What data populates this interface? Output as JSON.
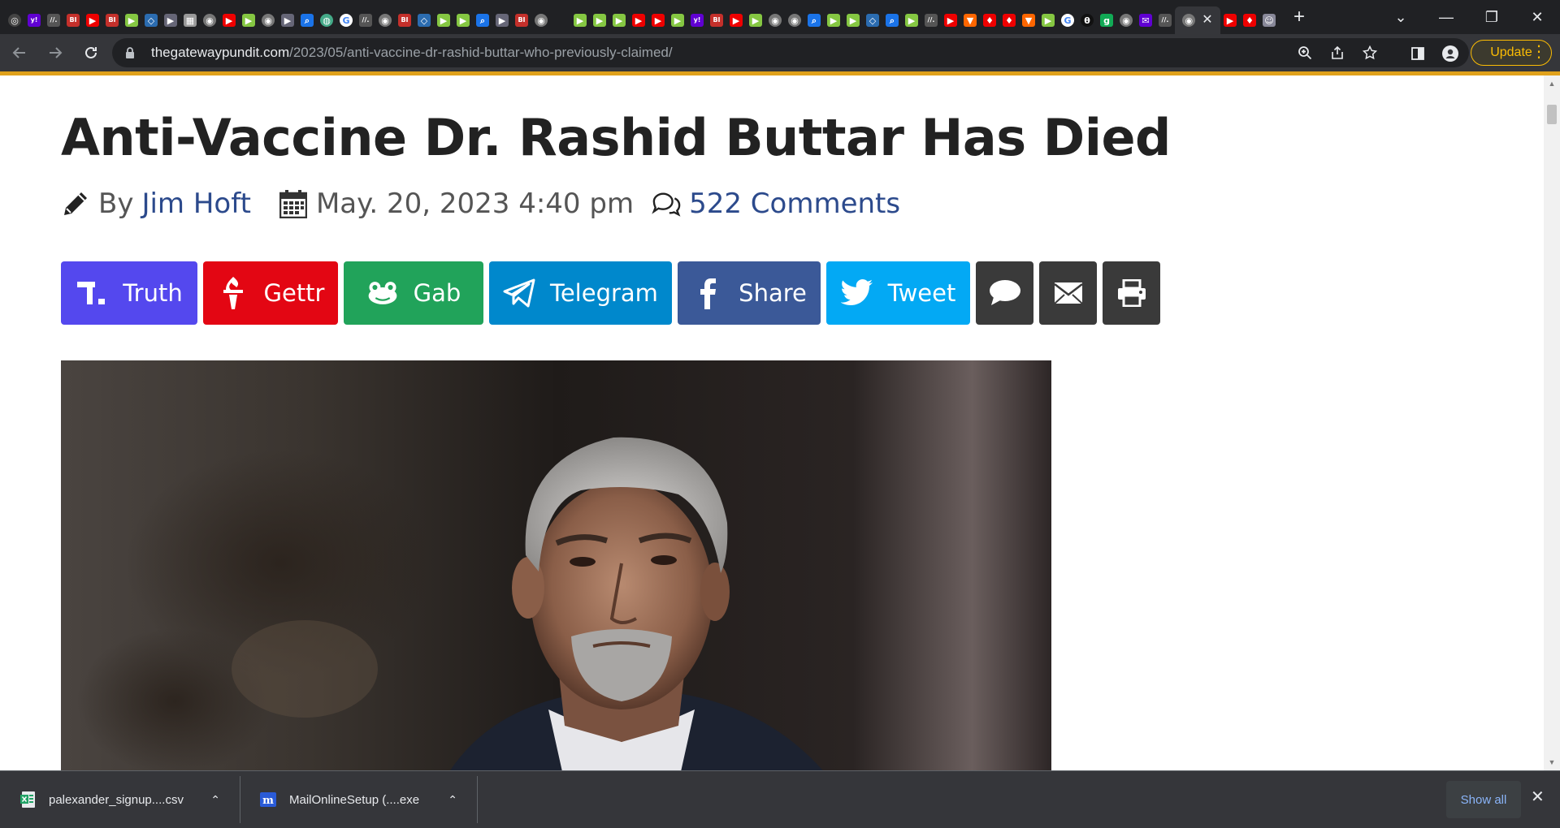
{
  "tabs": [
    {
      "icon": "chrome-favicon",
      "color": "#444",
      "glyph": "◎",
      "circle": true
    },
    {
      "icon": "yahoo-favicon",
      "color": "#6001d2",
      "glyph": "y!"
    },
    {
      "icon": "news-favicon",
      "color": "#555",
      "glyph": "//."
    },
    {
      "icon": "bi-favicon",
      "color": "#c4302b",
      "glyph": "BI"
    },
    {
      "icon": "youtube-favicon",
      "color": "#e00",
      "glyph": "▶"
    },
    {
      "icon": "bi-favicon",
      "color": "#c4302b",
      "glyph": "BI"
    },
    {
      "icon": "rumble-favicon",
      "color": "#85c742",
      "glyph": "▶"
    },
    {
      "icon": "shield-favicon",
      "color": "#2b6cb0",
      "glyph": "◇"
    },
    {
      "icon": "flag-favicon",
      "color": "#667",
      "glyph": "▶"
    },
    {
      "icon": "grid-favicon",
      "color": "#999",
      "glyph": "▦"
    },
    {
      "icon": "globe-favicon",
      "color": "#777",
      "glyph": "◉",
      "circle": true
    },
    {
      "icon": "youtube-favicon",
      "color": "#e00",
      "glyph": "▶"
    },
    {
      "icon": "rumble-favicon",
      "color": "#85c742",
      "glyph": "▶"
    },
    {
      "icon": "globe-favicon",
      "color": "#777",
      "glyph": "◉",
      "circle": true
    },
    {
      "icon": "flag-favicon",
      "color": "#667",
      "glyph": "▶"
    },
    {
      "icon": "search-favicon",
      "color": "#1a73e8",
      "glyph": "⌕"
    },
    {
      "icon": "site-favicon",
      "color": "#4a8",
      "glyph": "◍",
      "circle": true
    },
    {
      "icon": "google-favicon",
      "color": "#fff",
      "glyph": "G",
      "circle": true,
      "text": "#4285f4"
    },
    {
      "icon": "news-favicon",
      "color": "#555",
      "glyph": "//."
    },
    {
      "icon": "globe-favicon",
      "color": "#777",
      "glyph": "◉",
      "circle": true
    },
    {
      "icon": "bi-favicon",
      "color": "#c4302b",
      "glyph": "BI"
    },
    {
      "icon": "shield-favicon",
      "color": "#2b6cb0",
      "glyph": "◇"
    },
    {
      "icon": "rumble-favicon",
      "color": "#85c742",
      "glyph": "▶"
    },
    {
      "icon": "rumble-favicon",
      "color": "#85c742",
      "glyph": "▶"
    },
    {
      "icon": "search-favicon",
      "color": "#1a73e8",
      "glyph": "⌕"
    },
    {
      "icon": "flag-favicon",
      "color": "#667",
      "glyph": "▶"
    },
    {
      "icon": "bi-favicon",
      "color": "#c4302b",
      "glyph": "BI"
    },
    {
      "icon": "globe-favicon",
      "color": "#777",
      "glyph": "◉",
      "circle": true
    },
    {
      "icon": "blank-favicon",
      "color": "#202124",
      "glyph": ""
    },
    {
      "icon": "rumble-favicon",
      "color": "#85c742",
      "glyph": "▶"
    },
    {
      "icon": "rumble-favicon",
      "color": "#85c742",
      "glyph": "▶"
    },
    {
      "icon": "rumble-favicon",
      "color": "#85c742",
      "glyph": "▶"
    },
    {
      "icon": "youtube-favicon",
      "color": "#e00",
      "glyph": "▶"
    },
    {
      "icon": "youtube-favicon",
      "color": "#e00",
      "glyph": "▶"
    },
    {
      "icon": "rumble-favicon",
      "color": "#85c742",
      "glyph": "▶"
    },
    {
      "icon": "yahoo-favicon",
      "color": "#6001d2",
      "glyph": "y!"
    },
    {
      "icon": "bi-favicon",
      "color": "#c4302b",
      "glyph": "BI"
    },
    {
      "icon": "youtube-favicon",
      "color": "#e00",
      "glyph": "▶"
    },
    {
      "icon": "rumble-favicon",
      "color": "#85c742",
      "glyph": "▶"
    },
    {
      "icon": "globe-favicon",
      "color": "#777",
      "glyph": "◉",
      "circle": true
    },
    {
      "icon": "globe-favicon",
      "color": "#777",
      "glyph": "◉",
      "circle": true
    },
    {
      "icon": "search-favicon",
      "color": "#1a73e8",
      "glyph": "⌕"
    },
    {
      "icon": "rumble-favicon",
      "color": "#85c742",
      "glyph": "▶"
    },
    {
      "icon": "rumble-favicon",
      "color": "#85c742",
      "glyph": "▶"
    },
    {
      "icon": "shield-favicon",
      "color": "#2b6cb0",
      "glyph": "◇"
    },
    {
      "icon": "search-favicon",
      "color": "#1a73e8",
      "glyph": "⌕"
    },
    {
      "icon": "rumble-favicon",
      "color": "#85c742",
      "glyph": "▶"
    },
    {
      "icon": "news-favicon",
      "color": "#555",
      "glyph": "//."
    },
    {
      "icon": "youtube-favicon",
      "color": "#e00",
      "glyph": "▶"
    },
    {
      "icon": "bookmark-favicon",
      "color": "#f60",
      "glyph": "▼"
    },
    {
      "icon": "torch-favicon",
      "color": "#e00",
      "glyph": "♦"
    },
    {
      "icon": "torch-favicon",
      "color": "#e00",
      "glyph": "♦"
    },
    {
      "icon": "bookmark-favicon",
      "color": "#f60",
      "glyph": "▼"
    },
    {
      "icon": "rumble-favicon",
      "color": "#85c742",
      "glyph": "▶"
    },
    {
      "icon": "google-favicon",
      "color": "#fff",
      "glyph": "G",
      "circle": true,
      "text": "#4285f4"
    },
    {
      "icon": "dark-favicon",
      "color": "#111",
      "glyph": "θ",
      "circle": true
    },
    {
      "icon": "g-favicon",
      "color": "#1a5",
      "glyph": "g"
    },
    {
      "icon": "globe-favicon",
      "color": "#777",
      "glyph": "◉",
      "circle": true
    },
    {
      "icon": "mail-favicon",
      "color": "#6001d2",
      "glyph": "✉"
    },
    {
      "icon": "news-favicon",
      "color": "#555",
      "glyph": "//."
    },
    {
      "icon": "globe-favicon",
      "color": "#777",
      "glyph": "◉",
      "circle": true
    },
    {
      "icon": "youtube-favicon",
      "color": "#e00",
      "glyph": "▶"
    },
    {
      "icon": "torch-favicon",
      "color": "#e00",
      "glyph": "♦"
    },
    {
      "icon": "avatar-favicon",
      "color": "#889",
      "glyph": "☺"
    }
  ],
  "active_tab_index": 60,
  "tab_close_glyph": "✕",
  "new_tab_glyph": "+",
  "window": {
    "dropdown": "⌄",
    "minimize": "—",
    "restore": "❐",
    "close": "✕"
  },
  "address": {
    "host": "thegatewaypundit.com",
    "path": "/2023/05/anti-vaccine-dr-rashid-buttar-who-previously-claimed/"
  },
  "toolbar": {
    "update_label": "Update",
    "menu_glyph": "⋮"
  },
  "article": {
    "title": "Anti-Vaccine Dr. Rashid Buttar Has Died",
    "by_label": "By",
    "author": "Jim Hoft",
    "date": "May. 20, 2023 4:40 pm",
    "comments": "522 Comments"
  },
  "share_buttons": [
    {
      "key": "truth",
      "label": "Truth",
      "color": "#5448ee",
      "width": 168
    },
    {
      "key": "gettr",
      "label": "Gettr",
      "color": "#e30613",
      "width": 166
    },
    {
      "key": "gab",
      "label": "Gab",
      "color": "#21a35a",
      "width": 172
    },
    {
      "key": "telegram",
      "label": "Telegram",
      "color": "#0088cc",
      "width": 225
    },
    {
      "key": "facebook",
      "label": "Share",
      "color": "#3b5998",
      "width": 176
    },
    {
      "key": "twitter",
      "label": "Tweet",
      "color": "#03a9f4",
      "width": 177
    }
  ],
  "colors": {
    "accent": "#e0a11b",
    "link": "#2c4a8c"
  },
  "downloads": [
    {
      "name": "palexander_signup....csv",
      "icon": "excel-icon",
      "caret": "⌃"
    },
    {
      "name": "MailOnlineSetup (....exe",
      "icon": "mailonline-icon",
      "caret": "⌃"
    }
  ],
  "shelf": {
    "show_all": "Show all",
    "close": "✕"
  }
}
